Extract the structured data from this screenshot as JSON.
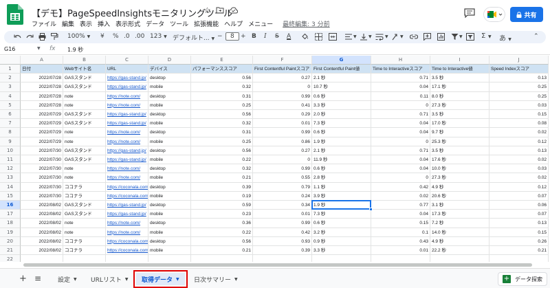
{
  "doc": {
    "title": "【デモ】PageSpeedInsightsモニタリングツール",
    "menus": [
      "ファイル",
      "編集",
      "表示",
      "挿入",
      "表示形式",
      "データ",
      "ツール",
      "拡張機能",
      "ヘルプ",
      "メニュー"
    ],
    "last_edit": "最終編集: 3 分前",
    "share_label": "共有"
  },
  "colors": {
    "accent": "#1a73e8",
    "header_fill": "#cfe2f3",
    "link": "#1155cc",
    "sheets_green": "#0f9d58",
    "highlight_red": "#e00000"
  },
  "toolbar": {
    "zoom": "100%",
    "currency": "¥",
    "percent": "%",
    "dec_decrease": ".0",
    "dec_increase": ".00",
    "format_123": "123",
    "font_family": "デフォルト...",
    "font_size": "8",
    "bold": "B",
    "italic": "I",
    "strike": "S",
    "text_color": "A",
    "input_tools": "あ"
  },
  "formula": {
    "cell_ref": "G16",
    "fx": "fx",
    "value": "1.9 秒"
  },
  "grid": {
    "columns": [
      "A",
      "B",
      "C",
      "D",
      "E",
      "F",
      "G",
      "H",
      "I",
      "J"
    ],
    "header_row": [
      "日付",
      "Webサイト名",
      "URL",
      "デバイス",
      "パフォーマンススコア",
      "First Contentful Paintスコア",
      "First Contentful Paint値",
      "Time to Interactiveスコア",
      "Time to Interactive値",
      "Speed Indexスコア"
    ],
    "rows": [
      [
        "2022/07/28",
        "GASスタンド",
        "https://gas-stand.jp/",
        "desktop",
        "0.56",
        "0.27",
        "2.1 秒",
        "0.71",
        "3.5 秒",
        "0.13"
      ],
      [
        "2022/07/28",
        "GASスタンド",
        "https://gas-stand.jp/",
        "mobile",
        "0.32",
        "0",
        "10.7 秒",
        "0.04",
        "17.1 秒",
        "0.25"
      ],
      [
        "2022/07/28",
        "note",
        "https://note.com/",
        "desktop",
        "0.31",
        "0.99",
        "0.6 秒",
        "0.11",
        "8.0 秒",
        "0.25"
      ],
      [
        "2022/07/28",
        "note",
        "https://note.com/",
        "mobile",
        "0.25",
        "0.41",
        "3.3 秒",
        "0",
        "27.3 秒",
        "0.03"
      ],
      [
        "2022/07/29",
        "GASスタンド",
        "https://gas-stand.jp/",
        "desktop",
        "0.56",
        "0.29",
        "2.0 秒",
        "0.71",
        "3.5 秒",
        "0.15"
      ],
      [
        "2022/07/29",
        "GASスタンド",
        "https://gas-stand.jp/",
        "mobile",
        "0.32",
        "0.01",
        "7.3 秒",
        "0.04",
        "17.0 秒",
        "0.08"
      ],
      [
        "2022/07/29",
        "note",
        "https://note.com/",
        "desktop",
        "0.31",
        "0.99",
        "0.6 秒",
        "0.04",
        "9.7 秒",
        "0.02"
      ],
      [
        "2022/07/29",
        "note",
        "https://note.com/",
        "mobile",
        "0.25",
        "0.86",
        "1.9 秒",
        "0",
        "25.3 秒",
        "0.12"
      ],
      [
        "2022/07/30",
        "GASスタンド",
        "https://gas-stand.jp/",
        "desktop",
        "0.56",
        "0.27",
        "2.1 秒",
        "0.71",
        "3.5 秒",
        "0.13"
      ],
      [
        "2022/07/30",
        "GASスタンド",
        "https://gas-stand.jp/",
        "mobile",
        "0.22",
        "0",
        "11.9 秒",
        "0.04",
        "17.6 秒",
        "0.02"
      ],
      [
        "2022/07/30",
        "note",
        "https://note.com/",
        "desktop",
        "0.32",
        "0.99",
        "0.6 秒",
        "0.04",
        "10.0 秒",
        "0.03"
      ],
      [
        "2022/07/30",
        "note",
        "https://note.com/",
        "mobile",
        "0.21",
        "0.55",
        "2.8 秒",
        "0",
        "27.3 秒",
        "0.02"
      ],
      [
        "2022/07/30",
        "ココナラ",
        "https://coconala.com/",
        "desktop",
        "0.39",
        "0.79",
        "1.1 秒",
        "0.42",
        "4.9 秒",
        "0.12"
      ],
      [
        "2022/07/30",
        "ココナラ",
        "https://coconala.com/",
        "mobile",
        "0.19",
        "0.24",
        "3.9 秒",
        "0.02",
        "20.6 秒",
        "0.07"
      ],
      [
        "2022/08/02",
        "GASスタンド",
        "https://gas-stand.jp/",
        "desktop",
        "0.59",
        "0.34",
        "1.9 秒",
        "0.77",
        "3.1 秒",
        "0.06"
      ],
      [
        "2022/08/02",
        "GASスタンド",
        "https://gas-stand.jp/",
        "mobile",
        "0.23",
        "0.01",
        "7.3 秒",
        "0.04",
        "17.3 秒",
        "0.07"
      ],
      [
        "2022/08/02",
        "note",
        "https://note.com/",
        "desktop",
        "0.36",
        "0.99",
        "0.6 秒",
        "0.15",
        "7.2 秒",
        "0.13"
      ],
      [
        "2022/08/02",
        "note",
        "https://note.com/",
        "mobile",
        "0.22",
        "0.42",
        "3.2 秒",
        "0.1",
        "14.0 秒",
        "0.15"
      ],
      [
        "2022/08/02",
        "ココナラ",
        "https://coconala.com/",
        "desktop",
        "0.56",
        "0.93",
        "0.9 秒",
        "0.43",
        "4.9 秒",
        "0.26"
      ],
      [
        "2022/08/02",
        "ココナラ",
        "https://coconala.com/",
        "mobile",
        "0.21",
        "0.39",
        "3.3 秒",
        "0.01",
        "22.2 秒",
        "0.21"
      ]
    ],
    "row_numbers": [
      "1",
      "2",
      "3",
      "4",
      "5",
      "6",
      "7",
      "8",
      "9",
      "10",
      "11",
      "12",
      "13",
      "14",
      "15",
      "16",
      "17",
      "18",
      "19",
      "20",
      "21",
      "22",
      "23"
    ],
    "selected_cell": "G16"
  },
  "sheets": {
    "add": "+",
    "list_icon": "≡",
    "tabs": [
      "設定",
      "URLリスト",
      "取得データ",
      "日次サマリー"
    ],
    "active_tab": "取得データ",
    "explore_label": "データ探索"
  }
}
